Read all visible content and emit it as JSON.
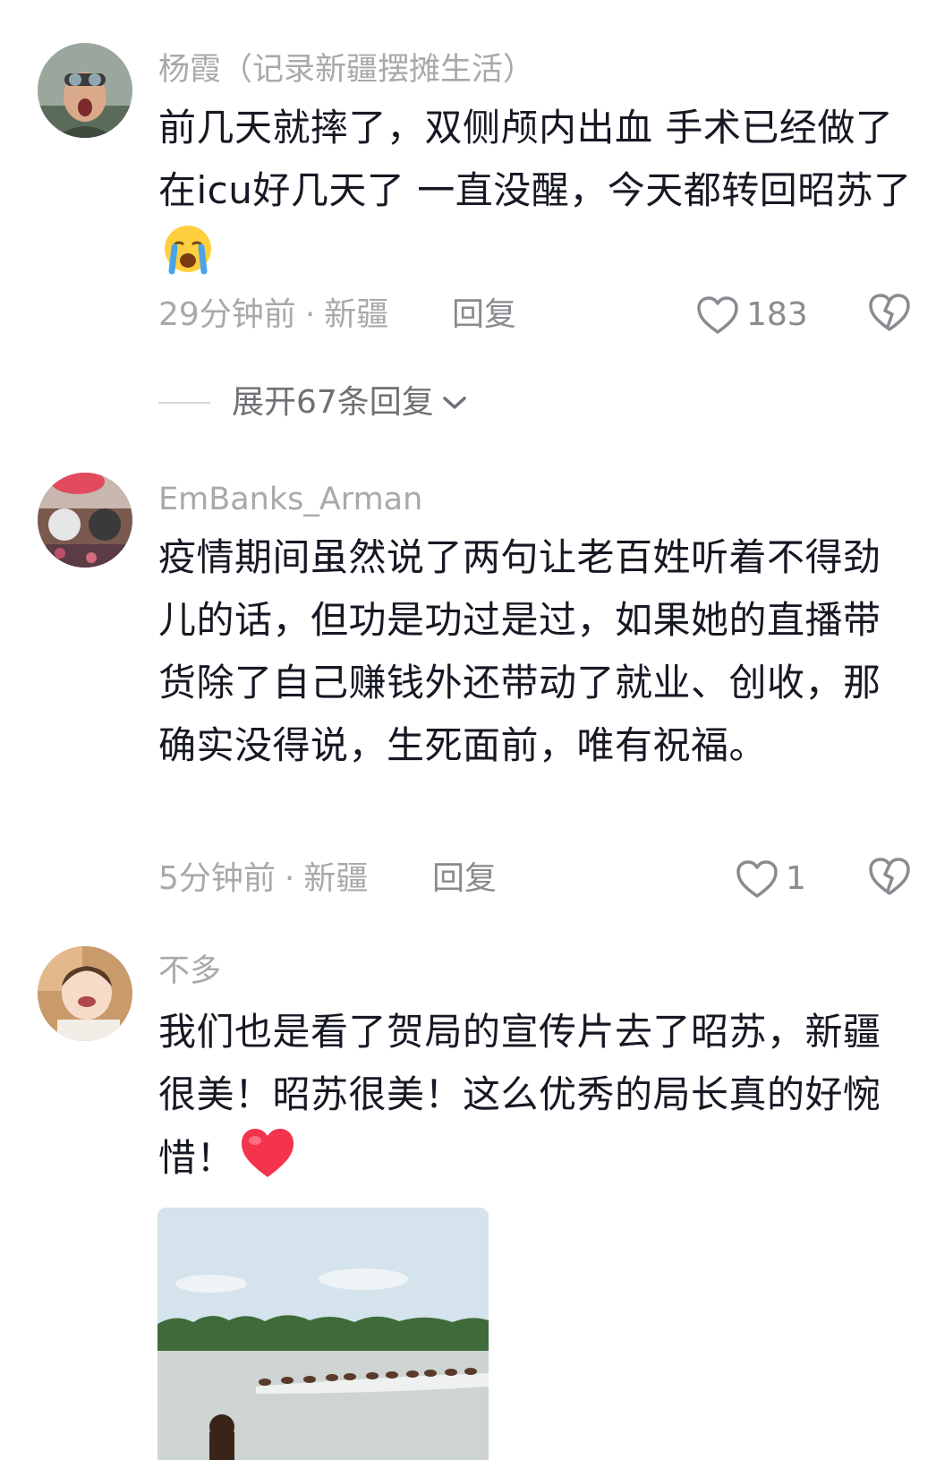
{
  "comments": [
    {
      "username": "杨霞（记录新疆摆摊生活）",
      "content_before_emoji": "前几天就摔了，双侧颅内出血 手术已经做了 在icu好几天了 一直没醒，今天都转回昭苏了",
      "emoji": "loudly-crying-face",
      "time": "29分钟前",
      "separator": "·",
      "location": "新疆",
      "reply_label": "回复",
      "likes": "183",
      "expand_label": "展开67条回复"
    },
    {
      "username": "EmBanks_Arman",
      "content": "疫情期间虽然说了两句让老百姓听着不得劲儿的话，但功是功过是过，如果她的直播带货除了自己赚钱外还带动了就业、创收，那确实没得说，生死面前，唯有祝福。",
      "time": "5分钟前",
      "separator": "·",
      "location": "新疆",
      "reply_label": "回复",
      "likes": "1"
    },
    {
      "username": "不多",
      "content_before_emoji": "我们也是看了贺局的宣传片去了昭苏，新疆很美！昭苏很美！这么优秀的局长真的好惋惜！",
      "emoji": "red-heart",
      "attachment": "horses-crossing-river-photo"
    }
  ],
  "icons": {
    "like": "heart-outline-icon",
    "dislike": "broken-heart-outline-icon",
    "expand": "chevron-down-icon"
  },
  "colors": {
    "text": "#161823",
    "secondary": "#a8a8ad",
    "action": "#8a8a90"
  }
}
